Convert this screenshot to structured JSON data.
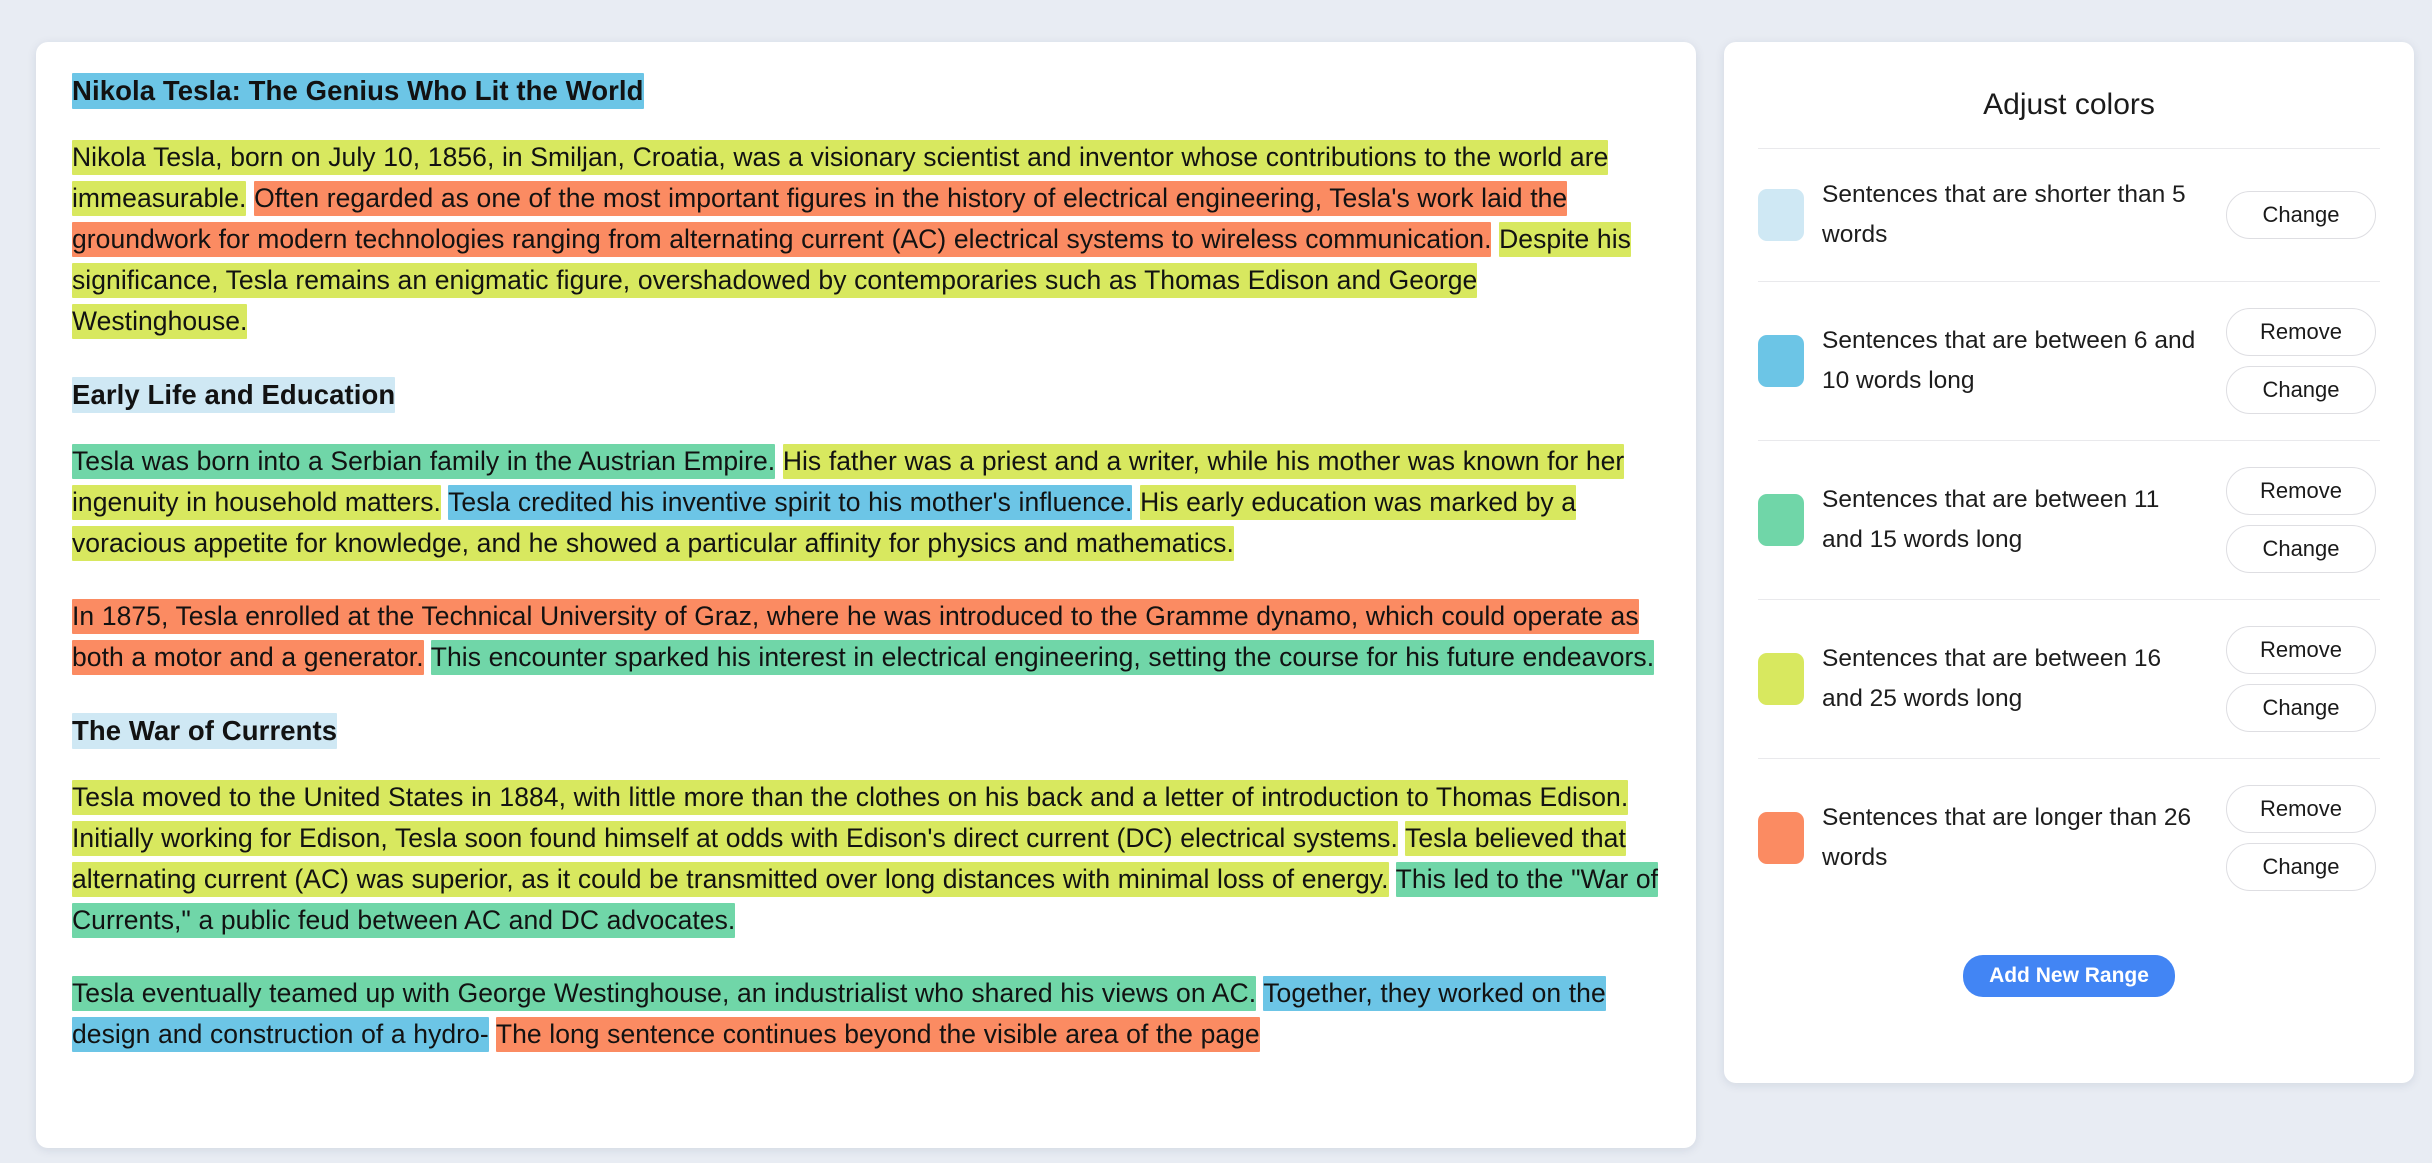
{
  "document": {
    "title": "Nikola Tesla: The Genius Who Lit the World",
    "blocks": [
      {
        "type": "heading",
        "segments": [
          {
            "text": "Nikola Tesla: The Genius Who Lit the World",
            "highlight": "hl-2"
          }
        ]
      },
      {
        "type": "paragraph",
        "segments": [
          {
            "text": "Nikola Tesla, born on July 10, 1856, in Smiljan, Croatia, was a visionary scientist and inventor whose contributions to the world are immeasurable.",
            "highlight": "hl-4"
          },
          {
            "text": " ",
            "highlight": "none"
          },
          {
            "text": "Often regarded as one of the most important figures in the history of electrical engineering, Tesla's work laid the groundwork for modern technologies ranging from alternating current (AC) electrical systems to wireless communication.",
            "highlight": "hl-5"
          },
          {
            "text": " ",
            "highlight": "none"
          },
          {
            "text": "Despite his significance, Tesla remains an enigmatic figure, overshadowed by contemporaries such as Thomas Edison and George Westinghouse.",
            "highlight": "hl-4"
          }
        ]
      },
      {
        "type": "heading",
        "segments": [
          {
            "text": "Early Life and Education",
            "highlight": "hl-1"
          }
        ]
      },
      {
        "type": "paragraph",
        "segments": [
          {
            "text": "Tesla was born into a Serbian family in the Austrian Empire.",
            "highlight": "hl-3"
          },
          {
            "text": " ",
            "highlight": "none"
          },
          {
            "text": "His father was a priest and a writer, while his mother was known for her ingenuity in household matters.",
            "highlight": "hl-4"
          },
          {
            "text": " ",
            "highlight": "none"
          },
          {
            "text": "Tesla credited his inventive spirit to his mother's influence.",
            "highlight": "hl-2"
          },
          {
            "text": " ",
            "highlight": "none"
          },
          {
            "text": "His early education was marked by a voracious appetite for knowledge, and he showed a particular affinity for physics and mathematics.",
            "highlight": "hl-4"
          }
        ]
      },
      {
        "type": "paragraph",
        "segments": [
          {
            "text": "In 1875, Tesla enrolled at the Technical University of Graz, where he was introduced to the Gramme dynamo, which could operate as both a motor and a generator.",
            "highlight": "hl-5"
          },
          {
            "text": " ",
            "highlight": "none"
          },
          {
            "text": "This encounter sparked his interest in electrical engineering, setting the course for his future endeavors.",
            "highlight": "hl-3"
          }
        ]
      },
      {
        "type": "heading",
        "segments": [
          {
            "text": "The War of Currents",
            "highlight": "hl-1"
          }
        ]
      },
      {
        "type": "paragraph",
        "segments": [
          {
            "text": "Tesla moved to the United States in 1884, with little more than the clothes on his back and a letter of introduction to Thomas Edison.",
            "highlight": "hl-4"
          },
          {
            "text": " ",
            "highlight": "none"
          },
          {
            "text": "Initially working for Edison, Tesla soon found himself at odds with Edison's direct current (DC) electrical systems.",
            "highlight": "hl-4"
          },
          {
            "text": " ",
            "highlight": "none"
          },
          {
            "text": "Tesla believed that alternating current (AC) was superior, as it could be transmitted over long distances with minimal loss of energy.",
            "highlight": "hl-4"
          },
          {
            "text": " ",
            "highlight": "none"
          },
          {
            "text": "This led to the \"War of Currents,\" a public feud between AC and DC advocates.",
            "highlight": "hl-3"
          }
        ]
      },
      {
        "type": "paragraph",
        "segments": [
          {
            "text": "Tesla eventually teamed up with George Westinghouse, an industrialist who shared his views on AC.",
            "highlight": "hl-3"
          },
          {
            "text": " ",
            "highlight": "none"
          },
          {
            "text": "Together, they worked on the design and construction of a hydro-",
            "highlight": "hl-2"
          },
          {
            "text": " ",
            "highlight": "none"
          },
          {
            "text": "The long sentence continues beyond the visible area of the page",
            "highlight": "hl-5"
          }
        ]
      }
    ]
  },
  "panel": {
    "title": "Adjust colors",
    "add_button": "Add New Range",
    "remove_label": "Remove",
    "change_label": "Change",
    "ranges": [
      {
        "color": "#cfe8f4",
        "swatch_class": "sw-1",
        "label": "Sentences that are shorter than 5 words",
        "has_remove": false,
        "has_change": true
      },
      {
        "color": "#6cc5e6",
        "swatch_class": "sw-2",
        "label": "Sentences that are between 6 and 10 words long",
        "has_remove": true,
        "has_change": true
      },
      {
        "color": "#70d6a8",
        "swatch_class": "sw-3",
        "label": "Sentences that are between 11 and 15 words long",
        "has_remove": true,
        "has_change": true
      },
      {
        "color": "#d8e85f",
        "swatch_class": "sw-4",
        "label": "Sentences that are between 16 and 25 words long",
        "has_remove": true,
        "has_change": true
      },
      {
        "color": "#fb8b62",
        "swatch_class": "sw-5",
        "label": "Sentences that are longer than 26 words",
        "has_remove": true,
        "has_change": true
      }
    ]
  },
  "theme": {
    "page_background": "#e8ecf3",
    "card_background": "#ffffff",
    "accent": "#4285f4",
    "divider": "#e9e9ec"
  }
}
